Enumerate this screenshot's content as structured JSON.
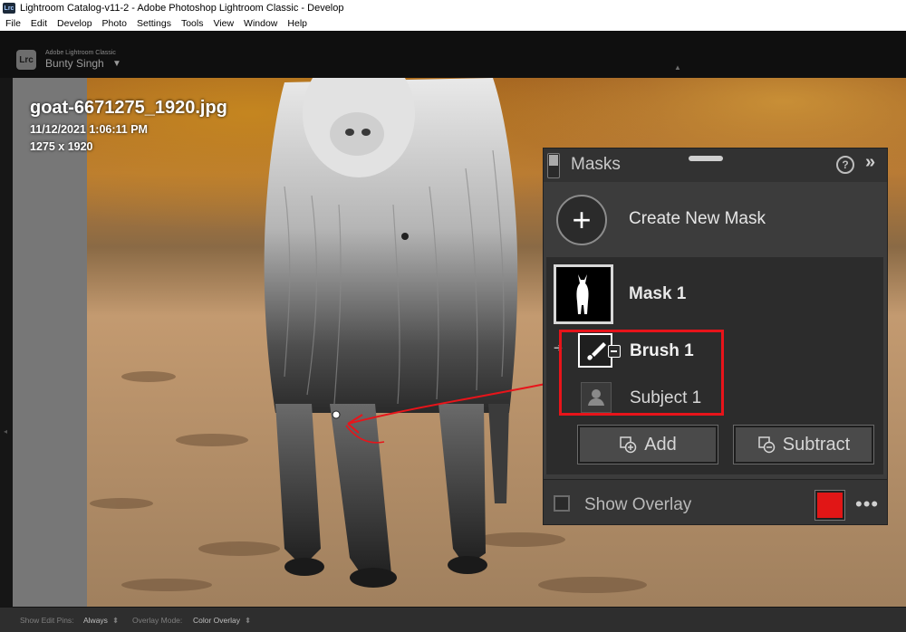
{
  "window": {
    "title": "Lightroom Catalog-v11-2 - Adobe Photoshop Lightroom Classic - Develop",
    "app_icon": "Lrc"
  },
  "menu": [
    "File",
    "Edit",
    "Develop",
    "Photo",
    "Settings",
    "Tools",
    "View",
    "Window",
    "Help"
  ],
  "identity": {
    "badge": "Lrc",
    "brand": "Adobe Lightroom Classic",
    "user": "Bunty Singh",
    "caret": "▼",
    "collapse_arrow": "▲"
  },
  "photo_info": {
    "file_name": "goat-6671275_1920.jpg",
    "date": "11/12/2021 1:06:11 PM",
    "dimensions": "1275 x 1920"
  },
  "masks_panel": {
    "title": "Masks",
    "help_icon": "?",
    "collapse_icon": "»",
    "create_symbol": "+",
    "create_label": "Create New Mask",
    "mask_name": "Mask 1",
    "row_arrow": "➔",
    "components": [
      {
        "label": "Brush 1",
        "icon": "brush-icon",
        "selected": true
      },
      {
        "label": "Subject 1",
        "icon": "subject-icon",
        "selected": false
      }
    ],
    "add_label": "Add",
    "subtract_label": "Subtract",
    "show_overlay_label": "Show Overlay",
    "show_overlay_checked": false,
    "overlay_color": "#e11616",
    "more_icon": "•••"
  },
  "bottom_toolbar": {
    "show_edit_pins_label": "Show Edit Pins:",
    "show_edit_pins_value": "Always",
    "overlay_mode_label": "Overlay Mode:",
    "overlay_mode_value": "Color Overlay",
    "spinner": "⬍"
  },
  "colors": {
    "annotation_red": "#e8141a",
    "panel_bg": "#3c3c3c"
  }
}
